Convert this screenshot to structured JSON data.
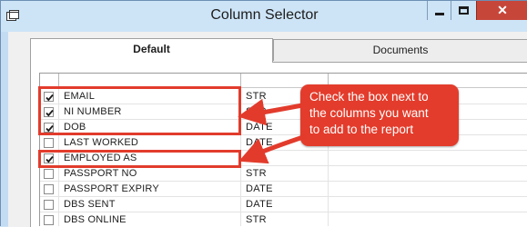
{
  "window": {
    "title": "Column Selector",
    "controls": {
      "minimize_icon": "minimize-icon",
      "maximize_icon": "maximize-icon",
      "close_glyph": "✕"
    }
  },
  "tabs": [
    {
      "label": "Default",
      "active": true
    },
    {
      "label": "Documents",
      "active": false
    }
  ],
  "grid": {
    "rows": [
      {
        "name": "EMAIL",
        "type": "STR",
        "checked": true
      },
      {
        "name": "NI NUMBER",
        "type": "STR",
        "checked": true
      },
      {
        "name": "DOB",
        "type": "DATE",
        "checked": true
      },
      {
        "name": "LAST WORKED",
        "type": "DATE",
        "checked": false
      },
      {
        "name": "EMPLOYED AS",
        "type": "STR",
        "checked": true
      },
      {
        "name": "PASSPORT NO",
        "type": "STR",
        "checked": false
      },
      {
        "name": "PASSPORT EXPIRY",
        "type": "DATE",
        "checked": false
      },
      {
        "name": "DBS SENT",
        "type": "DATE",
        "checked": false
      },
      {
        "name": "DBS ONLINE",
        "type": "STR",
        "checked": false
      }
    ]
  },
  "annotation": {
    "text": "Check the box next to the columns you want to add to the report",
    "lines": [
      "Check the box next to",
      "the columns you want",
      "to add to the report"
    ],
    "color": "#e23b2c"
  },
  "colors": {
    "title_bar": "#cde4f7",
    "close_button": "#c7463a",
    "panel": "#ffffff"
  }
}
